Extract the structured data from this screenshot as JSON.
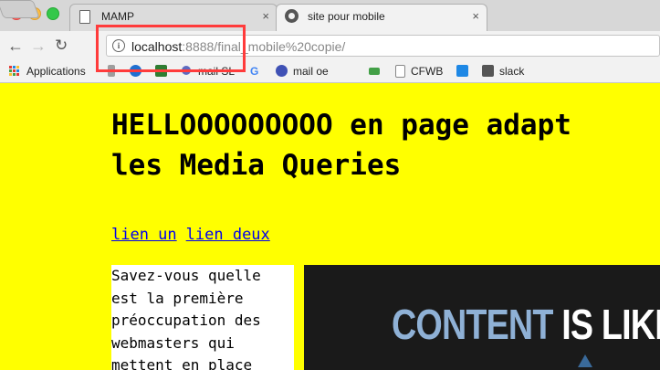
{
  "tabs": [
    {
      "title": "MAMP",
      "close": "×"
    },
    {
      "title": "site pour mobile",
      "close": "×"
    }
  ],
  "nav": {
    "back": "←",
    "forward": "→",
    "reload": "↻"
  },
  "address": {
    "host": "localhost",
    "rest": ":8888/final_mobile%20copie/",
    "info": "i"
  },
  "bookmarks": {
    "apps": "Applications",
    "items": [
      "mail SL",
      "mail oe",
      "CFWB",
      "slack"
    ]
  },
  "page": {
    "heading_line1": "HELLOOOOOOOOO en page adapt",
    "heading_line2": "les Media Queries",
    "link1": "lien un",
    "link2": "lien deux",
    "article_lines": [
      "Savez-vous quelle",
      "est la première",
      "préoccupation des",
      "webmasters qui",
      "mettent en place"
    ],
    "banner_word1": "CONTENT",
    "banner_word2": "IS LIKE W"
  },
  "colors": {
    "page_bg": "#ffff00",
    "highlight": "#ff3b3b",
    "link": "#0000ee"
  }
}
